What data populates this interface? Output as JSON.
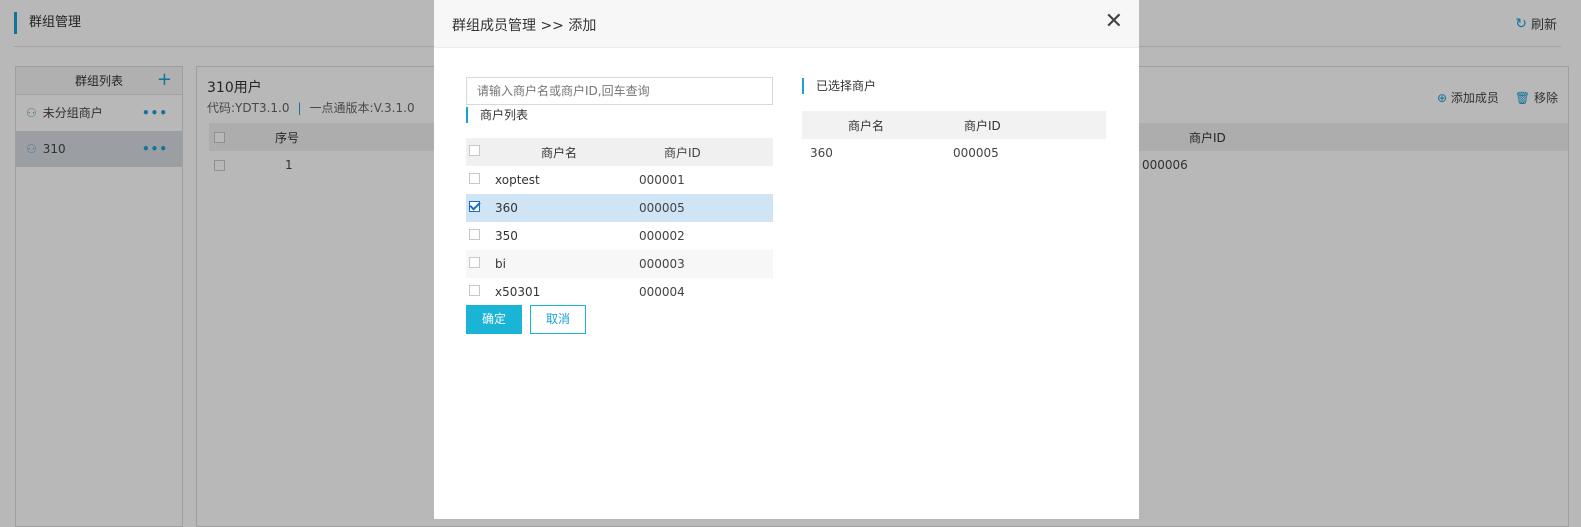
{
  "page": {
    "title": "群组管理",
    "refresh_label": "刷新"
  },
  "left_panel": {
    "header": "群组列表",
    "items": [
      {
        "label": "未分组商户"
      },
      {
        "label": "310"
      }
    ]
  },
  "right_panel": {
    "title": "310用户",
    "code": "代码:YDT3.1.0",
    "version": "一点通版本:V.3.1.0",
    "add_member_label": "添加成员",
    "remove_label": "移除",
    "columns": {
      "index": "序号",
      "id": "商户ID"
    },
    "rows": [
      {
        "index": "1",
        "id": "000006"
      }
    ]
  },
  "modal": {
    "title": "群组成员管理 >> 添加",
    "search_placeholder": "请输入商户名或商户ID,回车查询",
    "list_label": "商户列表",
    "selected_label": "已选择商户",
    "columns": {
      "name": "商户名",
      "id": "商户ID"
    },
    "list": [
      {
        "name": "xoptest",
        "id": "000001",
        "checked": false
      },
      {
        "name": "360",
        "id": "000005",
        "checked": true
      },
      {
        "name": "350",
        "id": "000002",
        "checked": false
      },
      {
        "name": "bi",
        "id": "000003",
        "checked": false
      },
      {
        "name": "x50301",
        "id": "000004",
        "checked": false
      }
    ],
    "selected": [
      {
        "name": "360",
        "id": "000005"
      }
    ],
    "ok_label": "确定",
    "cancel_label": "取消"
  },
  "colors": {
    "accent": "#1aa1d6",
    "primary_button": "#1ab5d6",
    "selected_row": "#cfe5f6"
  }
}
